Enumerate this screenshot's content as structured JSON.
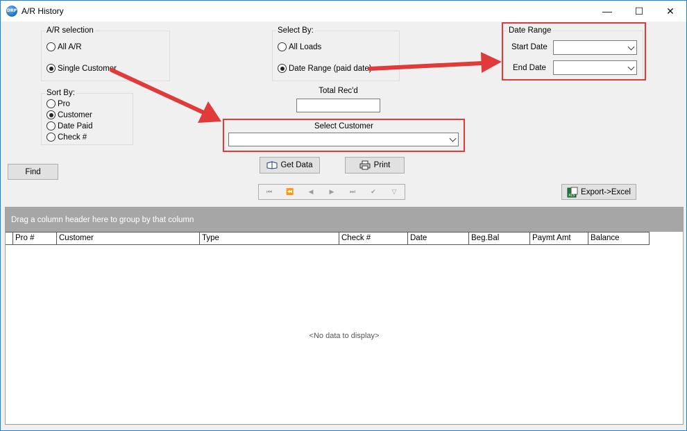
{
  "window": {
    "title": "A/R History",
    "icon": "app-logo-icon",
    "controls": {
      "minimize": "—",
      "maximize": "☐",
      "close": "✕"
    }
  },
  "ar_selection": {
    "label": "A/R selection",
    "options": [
      {
        "label": "All A/R",
        "selected": false
      },
      {
        "label": "Single Customer",
        "selected": true
      }
    ]
  },
  "select_by": {
    "label": "Select By:",
    "options": [
      {
        "label": "All Loads",
        "selected": false
      },
      {
        "label": "Date Range (paid date)",
        "selected": true
      }
    ]
  },
  "date_range": {
    "label": "Date Range",
    "start_label": "Start Date",
    "start_value": "",
    "end_label": "End Date",
    "end_value": ""
  },
  "sort_by": {
    "label": "Sort By:",
    "options": [
      {
        "label": "Pro",
        "selected": false
      },
      {
        "label": "Customer",
        "selected": true
      },
      {
        "label": "Date Paid",
        "selected": false
      },
      {
        "label": "Check #",
        "selected": false
      }
    ]
  },
  "total_recd": {
    "label": "Total Rec'd",
    "value": ""
  },
  "select_customer": {
    "label": "Select Customer",
    "value": ""
  },
  "buttons": {
    "find": "Find",
    "get_data": "Get Data",
    "print": "Print",
    "export": "Export->Excel"
  },
  "grid": {
    "group_prompt": "Drag a column header here to group by that column",
    "columns": [
      "Pro #",
      "Customer",
      "Type",
      "Check #",
      "Date",
      "Beg.Bal",
      "Paymt Amt",
      "Balance"
    ],
    "empty_text": "<No data to display>"
  },
  "accent_colors": {
    "annotation_red": "#e03a3a",
    "window_border": "#1883d7"
  }
}
